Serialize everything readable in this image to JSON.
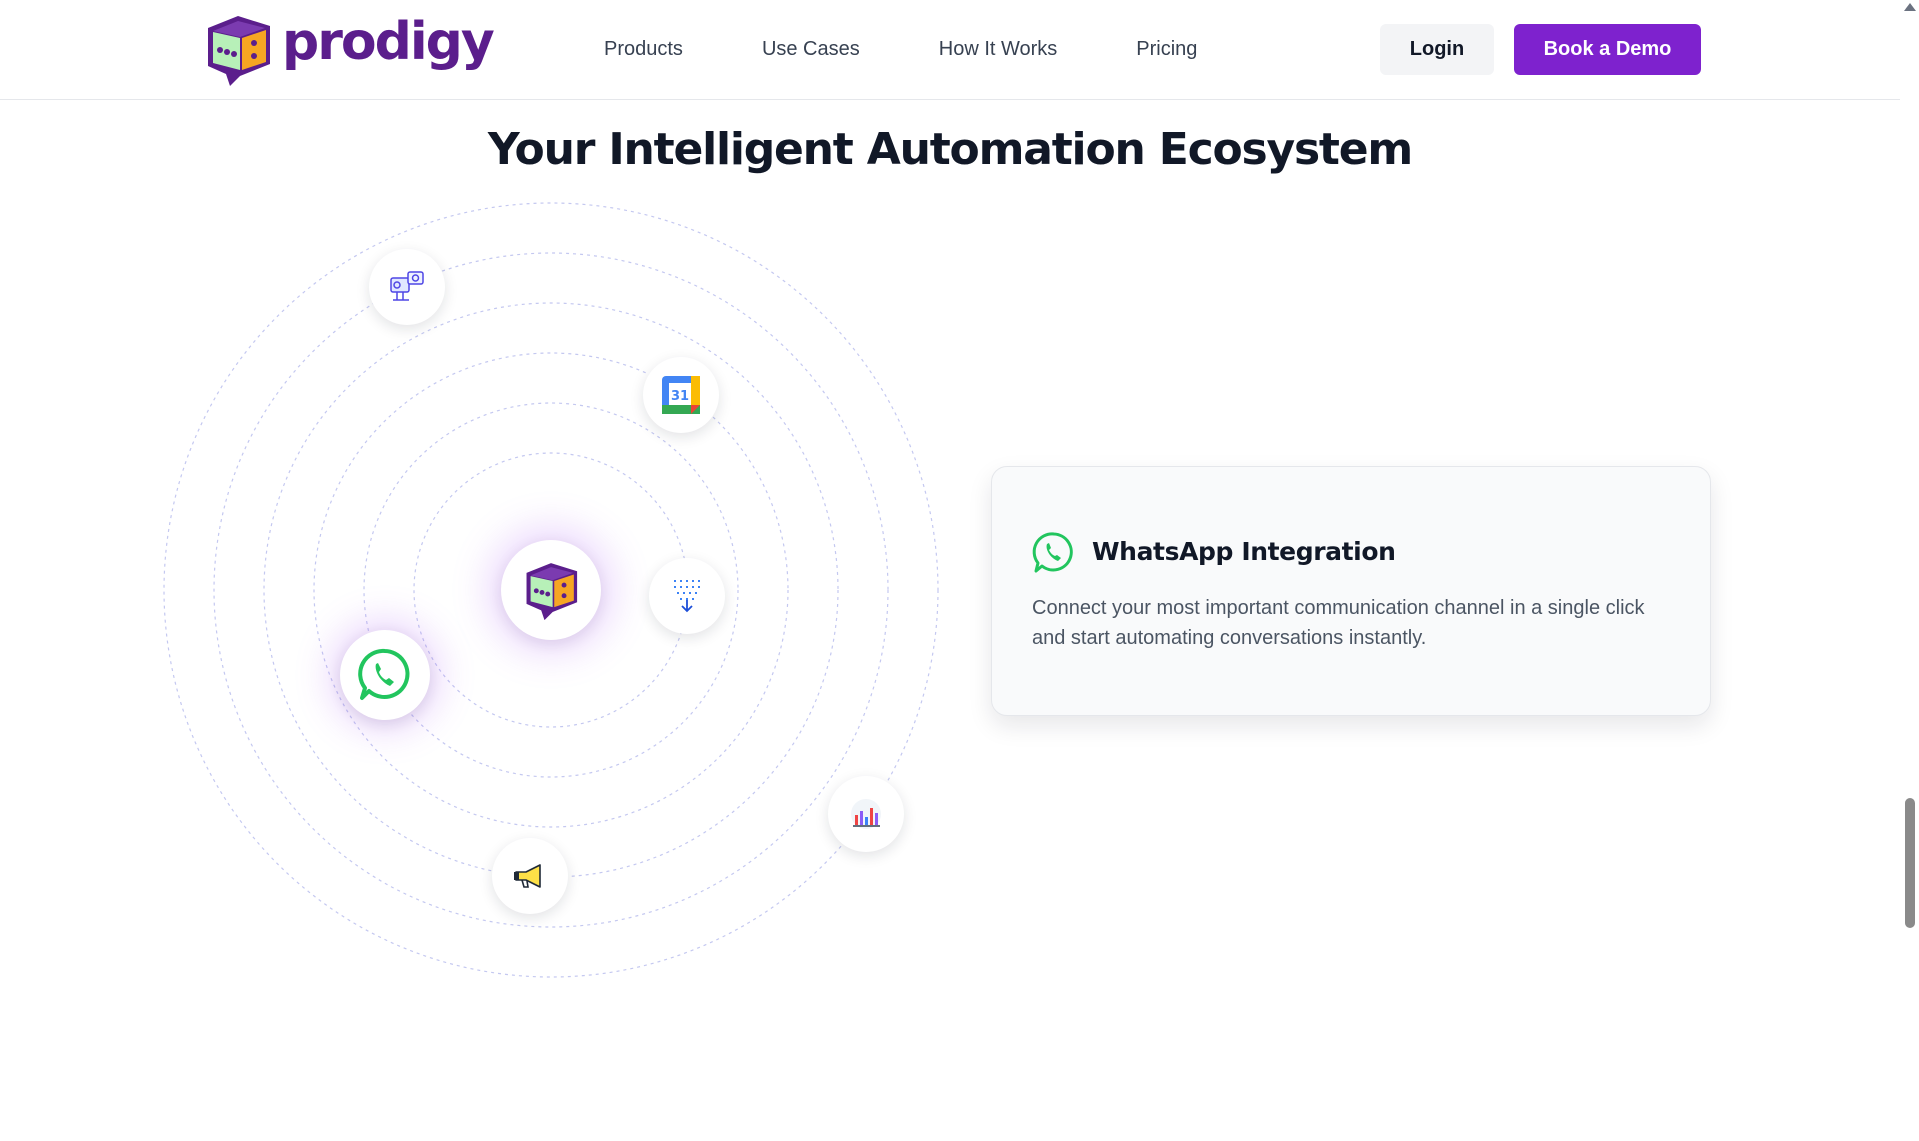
{
  "brand": {
    "name": "prodigy",
    "logo_icon": "chat-dice-logo-icon",
    "color": "#5b1e8c"
  },
  "nav": {
    "items": [
      {
        "label": "Products"
      },
      {
        "label": "Use Cases"
      },
      {
        "label": "How It Works"
      },
      {
        "label": "Pricing"
      }
    ]
  },
  "actions": {
    "login_label": "Login",
    "demo_label": "Book a Demo",
    "accent": "#7e22ce"
  },
  "section": {
    "title": "Your Intelligent Automation Ecosystem"
  },
  "orbit": {
    "center_icon": "prodigy-logo-icon",
    "nodes": [
      {
        "icon": "support-agent-icon",
        "active": false
      },
      {
        "icon": "google-calendar-icon",
        "active": false,
        "text": "31"
      },
      {
        "icon": "data-funnel-icon",
        "active": false
      },
      {
        "icon": "whatsapp-icon",
        "active": true
      },
      {
        "icon": "megaphone-icon",
        "active": false
      },
      {
        "icon": "analytics-chart-icon",
        "active": false
      }
    ]
  },
  "card": {
    "icon": "whatsapp-icon",
    "title": "WhatsApp Integration",
    "description": "Connect your most important communication channel in a single click and start automating conversations instantly.",
    "accent": "#25d366"
  }
}
